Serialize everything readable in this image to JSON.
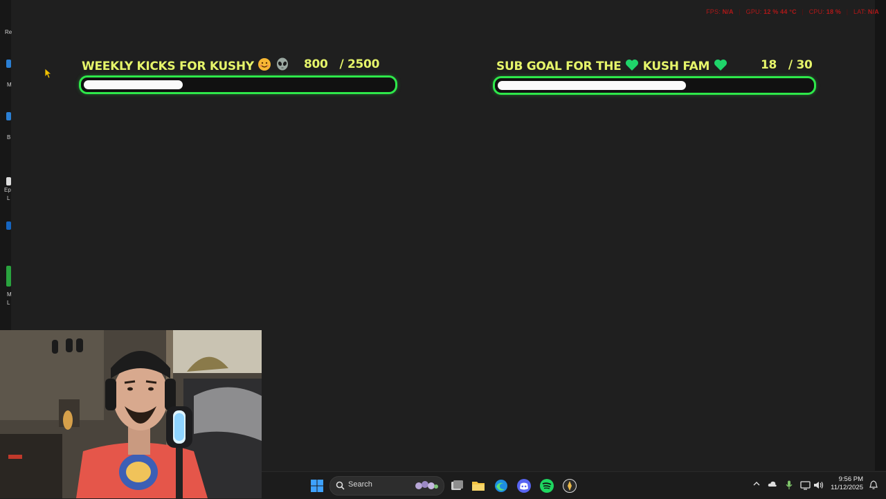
{
  "overlay": {
    "stats": [
      {
        "label": "FPS:",
        "value": "N/A"
      },
      {
        "label": "GPU:",
        "value": "12 % 44 °C"
      },
      {
        "label": "CPU:",
        "value": "18 %"
      },
      {
        "label": "LAT:",
        "value": "N/A"
      }
    ]
  },
  "goals": [
    {
      "title": "WEEKLY KICKS FOR KUSHY",
      "current": "800",
      "target": "/ 2500",
      "progress": 0.32
    },
    {
      "title_part1": "SUB GOAL FOR THE",
      "title_part2": "KUSH FAM",
      "current": "18",
      "target": "/ 30",
      "progress": 0.6
    }
  ],
  "desktop_labels": [
    "Re",
    "M",
    "B",
    "Ep",
    "L",
    "M",
    "L"
  ],
  "taskbar": {
    "search_label": "Search",
    "time": "9:56 PM",
    "date": "11/12/2025",
    "apps": [
      "start-icon",
      "search-icon",
      "task-view-icon",
      "file-explorer-icon",
      "edge-icon",
      "discord-icon",
      "spotify-icon",
      "obs-icon"
    ]
  },
  "colors": {
    "accent_green": "#2ee84a",
    "title_yellow": "#e6f56a",
    "stats_red": "#b01818",
    "bar_fill": "#fafafa"
  }
}
